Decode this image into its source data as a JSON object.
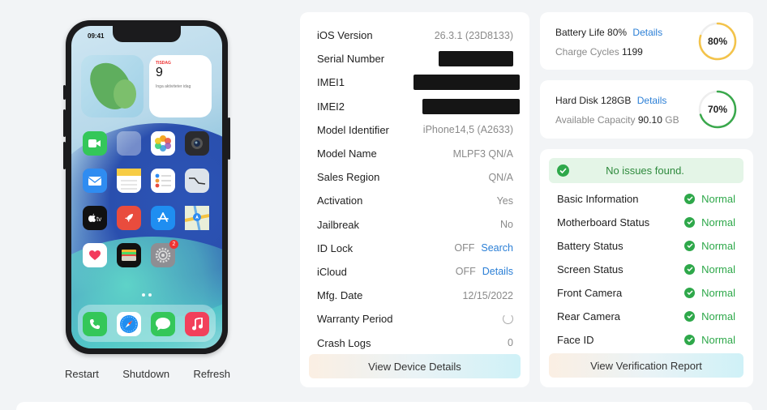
{
  "phone": {
    "status_time": "09:41",
    "calendar_widget": {
      "day": "TISDAG",
      "date": "9",
      "note": "Inga aktiviteter idag"
    },
    "settings_badge": "2",
    "actions": {
      "restart": "Restart",
      "shutdown": "Shutdown",
      "refresh": "Refresh"
    }
  },
  "device_info": {
    "rows": [
      {
        "label": "iOS Version",
        "value": "26.3.1 (23D8133)"
      },
      {
        "label": "Serial Number",
        "value": ""
      },
      {
        "label": "IMEI1",
        "value": ""
      },
      {
        "label": "IMEI2",
        "value": ""
      },
      {
        "label": "Model Identifier",
        "value": "iPhone14,5 (A2633)"
      },
      {
        "label": "Model Name",
        "value": "MLPF3 QN/A"
      },
      {
        "label": "Sales Region",
        "value": "QN/A"
      },
      {
        "label": "Activation",
        "value": "Yes"
      },
      {
        "label": "Jailbreak",
        "value": "No"
      },
      {
        "label": "ID Lock",
        "value": "OFF",
        "link": "Search"
      },
      {
        "label": "iCloud",
        "value": "OFF",
        "link": "Details"
      },
      {
        "label": "Mfg. Date",
        "value": "12/15/2022"
      },
      {
        "label": "Warranty Period",
        "value": ""
      },
      {
        "label": "Crash Logs",
        "value": "0"
      }
    ],
    "button": "View Device Details"
  },
  "battery": {
    "title": "Battery Life",
    "percent_text": "80%",
    "percent": 80,
    "details_link": "Details",
    "cycles_label": "Charge Cycles",
    "cycles_value": "1199",
    "ring_color": "#f3c34a"
  },
  "disk": {
    "title": "Hard Disk",
    "size": "128GB",
    "details_link": "Details",
    "capacity_label": "Available Capacity",
    "capacity_value": "90.10",
    "capacity_unit": "GB",
    "percent_text": "70%",
    "percent": 70,
    "ring_color": "#3aa84c"
  },
  "verification": {
    "banner": "No issues found.",
    "rows": [
      {
        "label": "Basic Information",
        "status": "Normal"
      },
      {
        "label": "Motherboard Status",
        "status": "Normal"
      },
      {
        "label": "Battery Status",
        "status": "Normal"
      },
      {
        "label": "Screen Status",
        "status": "Normal"
      },
      {
        "label": "Front Camera",
        "status": "Normal"
      },
      {
        "label": "Rear Camera",
        "status": "Normal"
      },
      {
        "label": "Face ID",
        "status": "Normal"
      }
    ],
    "button": "View Verification Report"
  }
}
